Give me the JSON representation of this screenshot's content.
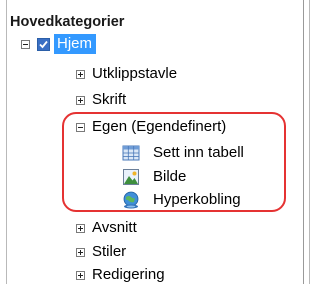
{
  "tree": {
    "header": "Hovedkategorier",
    "root": {
      "label": "Hjem",
      "checked": true,
      "expanded": true
    },
    "items": [
      {
        "label": "Utklippstavle",
        "expanded": false
      },
      {
        "label": "Skrift",
        "expanded": false
      },
      {
        "label": "Egen (Egendefinert)",
        "expanded": true,
        "commands": [
          {
            "label": "Sett inn tabell",
            "icon": "table-icon"
          },
          {
            "label": "Bilde",
            "icon": "picture-icon"
          },
          {
            "label": "Hyperkobling",
            "icon": "hyperlink-globe-icon"
          }
        ]
      },
      {
        "label": "Avsnitt",
        "expanded": false
      },
      {
        "label": "Stiler",
        "expanded": false
      },
      {
        "label": "Redigering",
        "expanded": false
      }
    ]
  },
  "colors": {
    "selection": "#3399ff",
    "highlight_outline": "#e53232"
  }
}
